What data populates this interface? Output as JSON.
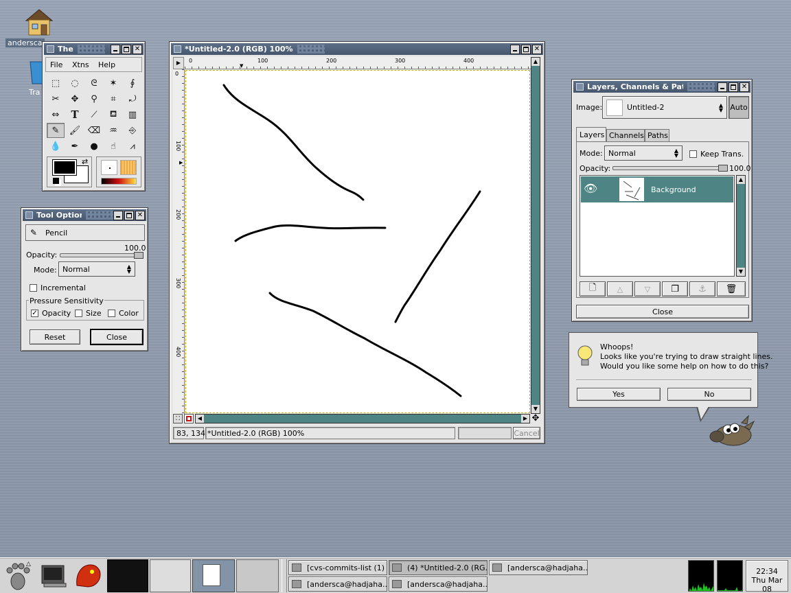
{
  "desktop": {
    "home_label": "andersca",
    "trash_label": "Tra"
  },
  "toolbox": {
    "title": "The",
    "menu": [
      "File",
      "Xtns",
      "Help"
    ],
    "tools": [
      "rect-select-icon",
      "ellipse-select-icon",
      "lasso-icon",
      "magic-wand-icon",
      "bezier-icon",
      "scissors-icon",
      "move-icon",
      "magnify-icon",
      "crop-icon",
      "transform-icon",
      "flip-icon",
      "text-icon",
      "color-picker-icon",
      "bucket-fill-icon",
      "gradient-icon",
      "pencil-icon",
      "paintbrush-icon",
      "eraser-icon",
      "airbrush-icon",
      "clone-icon",
      "blur-icon",
      "ink-icon",
      "dodge-icon",
      "smudge-icon",
      "measure-icon"
    ],
    "fg_color": "#000000",
    "bg_color": "#ffffff"
  },
  "tool_options": {
    "title": "Tool Option",
    "tool_name": "Pencil",
    "opacity_label": "Opacity:",
    "opacity_value": "100.0",
    "opacity_fraction": 1.0,
    "mode_label": "Mode:",
    "mode_value": "Normal",
    "incremental_label": "Incremental",
    "pressure_label": "Pressure Sensitivity",
    "pressure_opacity": "Opacity",
    "pressure_size": "Size",
    "pressure_color": "Color",
    "reset_label": "Reset",
    "close_label": "Close"
  },
  "image_window": {
    "title": "*Untitled-2.0 (RGB) 100%",
    "ruler_h": [
      "0",
      "100",
      "200",
      "300",
      "400"
    ],
    "ruler_v": [
      "0",
      "100",
      "200",
      "300",
      "400"
    ],
    "coords": "83, 134",
    "status": "*Untitled-2.0 (RGB) 100%",
    "cancel_label": "Cancel"
  },
  "layers": {
    "title": "Layers, Channels & Paths",
    "image_label": "Image:",
    "image_value": "Untitled-2",
    "auto_label": "Auto",
    "tabs": [
      "Layers",
      "Channels",
      "Paths"
    ],
    "mode_label": "Mode:",
    "mode_value": "Normal",
    "keep_trans_label": "Keep Trans.",
    "opacity_label": "Opacity:",
    "opacity_value": "100.0",
    "opacity_fraction": 1.0,
    "layer_name": "Background",
    "close_label": "Close",
    "accent": "#4e8584"
  },
  "whoops": {
    "line1": "Whoops!",
    "line2": "Looks like you're trying to draw straight lines.",
    "line3": "Would you like some help on how to do this?",
    "yes_label": "Yes",
    "no_label": "No"
  },
  "taskbar": {
    "tasks_row1": [
      "[cvs-commits-list (1) ...]",
      "(4) *Untitled-2.0 (RG...",
      "[andersca@hadjaha....]"
    ],
    "tasks_row2": [
      "[andersca@hadjaha....]",
      "[andersca@hadjaha....]"
    ],
    "time": "22:34",
    "date": "Thu Mar 08"
  }
}
